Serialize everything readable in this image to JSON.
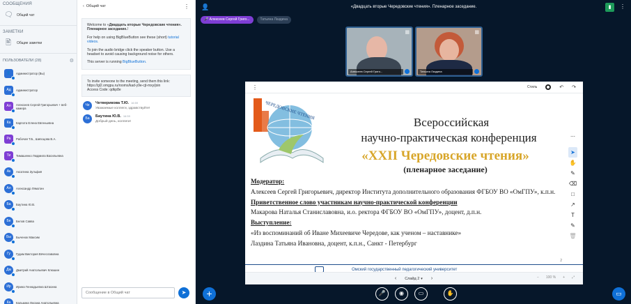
{
  "sidebar": {
    "messages_title": "СООБЩЕНИЯ",
    "public_chat": "Общий чат",
    "notes_title": "ЗАМЕТКИ",
    "shared_notes": "Общие заметки",
    "users_title": "ПОЛЬЗОВАТЕЛИ (28)",
    "users": [
      {
        "initials": "",
        "name": "Администратор (Вы)",
        "color": "#2C6FD6"
      },
      {
        "initials": "Ад",
        "name": "Администратор",
        "color": "#2C6FD6"
      },
      {
        "initials": "Ал",
        "name": "Алексеев Сергей Григорьевич + веб-камера",
        "color": "#7E3ED4"
      },
      {
        "initials": "Ка",
        "name": "Карпота Елена Евгеньевна",
        "color": "#2C6FD6"
      },
      {
        "initials": "Ра",
        "name": "Рабочая Т.Б., Шипоцова В.А.",
        "color": "#7E3ED4"
      },
      {
        "initials": "Ти",
        "name": "Тимашенко Людмила Васильевна",
        "color": "#7E3ED4"
      },
      {
        "initials": "Ак",
        "name": "Аксатина Зульфия",
        "color": "#2C6FD6"
      },
      {
        "initials": "Ал",
        "name": "Александр Лямотин",
        "color": "#2C6FD6"
      },
      {
        "initials": "Ба",
        "name": "Баутина Ю.В.",
        "color": "#2C6FD6"
      },
      {
        "initials": "Бе",
        "name": "Белов Савва",
        "color": "#2C6FD6"
      },
      {
        "initials": "Бы",
        "name": "Быченок Максим",
        "color": "#2C6FD6"
      },
      {
        "initials": "Гу",
        "name": "Гудим Виктория Вячеславовна",
        "color": "#2C6FD6"
      },
      {
        "initials": "Дм",
        "name": "Дмитрий Анатольевич Клюшин",
        "color": "#2C6FD6"
      },
      {
        "initials": "Ир",
        "name": "Ирина Геннадьевна Штасина",
        "color": "#2C6FD6"
      },
      {
        "initials": "Ка",
        "name": "Калькина Оксана Анатольевна",
        "color": "#2C6FD6"
      }
    ]
  },
  "chat": {
    "header": "Общий чат",
    "welcome_prefix": "Welcome to «",
    "welcome_title": "Двадцать вторые Чередовские чтения». Пленарное заседание.",
    "welcome_suffix": "!",
    "help_text": "For help on using BigBlueButton see these (short)",
    "help_link": "tutorial videos.",
    "audio_text": "To join the audio bridge click the speaker button. Use a headset to avoid causing background noise for others.",
    "running_text": "This server is running",
    "running_link": "BigBlueButton.",
    "invite_text": "To invite someone to the meeting, send them this link:",
    "invite_link": "https://gl2.omgpu.ru/rooms/kad-y9e-cjt-mxy/join",
    "access_code": "Access Code: qdkp8e",
    "messages": [
      {
        "initials": "Че",
        "author": "Четверикова Т.Ю.",
        "time": "16:59",
        "text": "Уважаемые коллеги, здравствуйте!",
        "color": "#2C6FD6"
      },
      {
        "initials": "Ба",
        "author": "Баутина Ю.В.",
        "time": "16:59",
        "text": "Добрый день, коллеги!",
        "color": "#2C6FD6"
      }
    ],
    "input_placeholder": "Сообщение в Общий чат"
  },
  "main": {
    "meeting_title": "«Двадцать вторые Чередовские чтения». Пленарное заседание.",
    "talkers": [
      "Алексеев Сергей Григо...",
      "Татьяна Лаздина"
    ],
    "videos": [
      {
        "name": "Алексеев Сергей Григо..."
      },
      {
        "name": "Татьяна Лаздина"
      }
    ]
  },
  "presentation": {
    "style_label": "Стиль",
    "logo_text": "ЧЕРЕДОВСКИЕ ЧТЕНИЯ",
    "title1": "Всероссийская",
    "title2": "научно-практическая конференция",
    "title3": "«XXII Чередовские чтения»",
    "title4": "(пленарное заседание)",
    "moderator_label": "Модератор:",
    "moderator_text": "Алексеев Сергей Григорьевич, директор Института дополнительного образования ФГБОУ ВО «ОмГПУ», к.п.н.",
    "greeting_label": "Приветственное слово участникам научно-практической конференции",
    "greeting_text": "Макарова Наталья Станиславовна, и.о. ректора ФГБОУ ВО «ОмГПУ», доцент, д.п.н.",
    "talks_label": "Выступление:",
    "talk_title": "«Из воспоминаний об Иване Михеевиче Чередове, как ученом – наставнике»",
    "talk_author": "Лаздина Татьяна Ивановна, доцент, к.п.н., Санкт - Петербург",
    "footer_text": "Омский государственный педагогический университет",
    "page_number": "2",
    "slide_label": "Слайд 2",
    "zoom": "100 %"
  },
  "colors": {
    "accent": "#0F70D7",
    "talker_active": "#7E3ED4",
    "slide_gold": "#D8A62A",
    "background": "#06172A"
  }
}
